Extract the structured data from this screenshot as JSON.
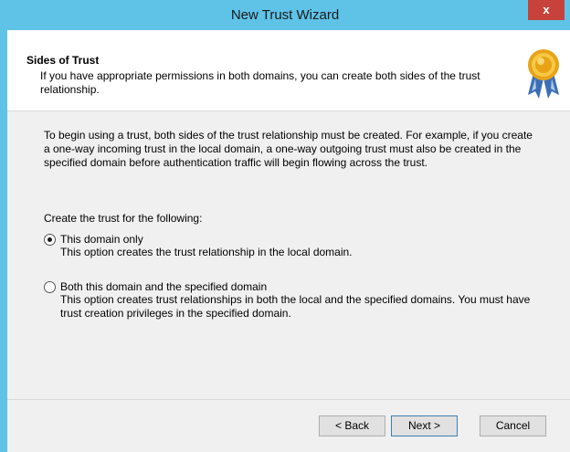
{
  "window": {
    "title": "New Trust Wizard",
    "close_glyph": "x"
  },
  "header": {
    "title": "Sides of Trust",
    "description": "If you have appropriate permissions in both domains, you can create both sides of the trust relationship.",
    "icon": "certificate-ribbon-icon"
  },
  "body": {
    "intro": "To begin using a trust, both sides of the trust relationship must be created. For example, if you create a one-way incoming trust in the local domain, a one-way outgoing trust must also be created in the specified domain before authentication traffic will begin flowing across the trust.",
    "prompt": "Create the trust for the following:",
    "options": [
      {
        "label": "This domain only",
        "description": "This option creates the trust relationship in the local domain.",
        "selected": true
      },
      {
        "label": "Both this domain and the specified domain",
        "description": "This option creates trust relationships in both the local and the specified domains. You must have trust creation privileges in the specified domain.",
        "selected": false
      }
    ]
  },
  "buttons": {
    "back": "< Back",
    "next": "Next >",
    "cancel": "Cancel"
  }
}
